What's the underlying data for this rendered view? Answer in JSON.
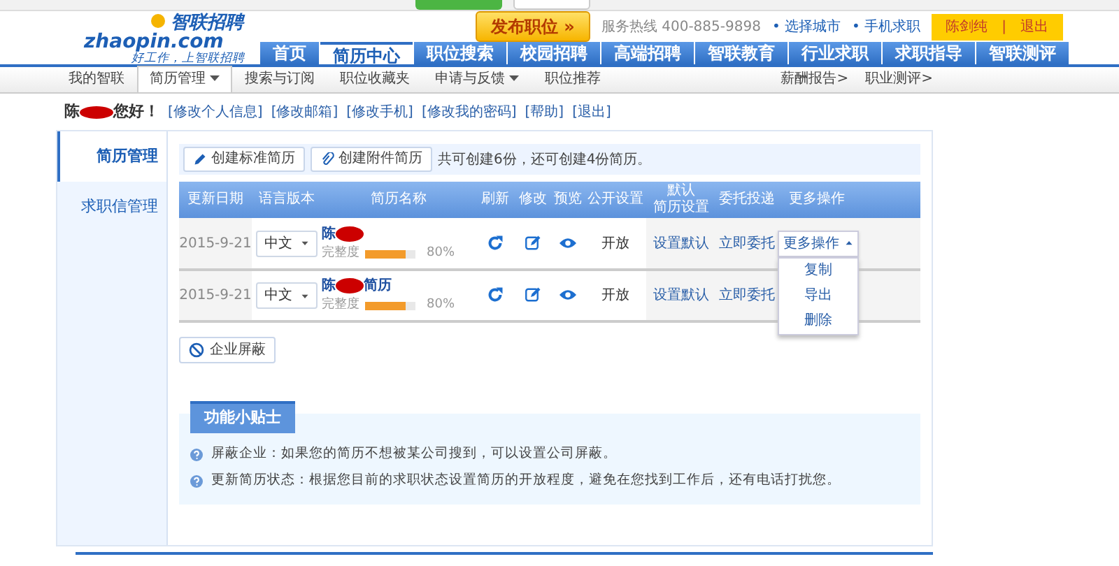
{
  "header": {
    "logo_cn": "智联招聘",
    "logo_en": "zhaopin.com",
    "slogan": "好工作，上智联招聘",
    "post_job": "发布职位 »",
    "hotline": "服务热线 400-885-9898",
    "links": [
      "• 选择城市",
      "• 手机求职"
    ],
    "user": {
      "name": "陈剑纯",
      "separator": "|",
      "logout": "退出"
    }
  },
  "main_nav": [
    {
      "label": "首页",
      "selected": false
    },
    {
      "label": "简历中心",
      "selected": true
    },
    {
      "label": "职位搜索",
      "selected": false
    },
    {
      "label": "校园招聘",
      "selected": false
    },
    {
      "label": "高端招聘",
      "selected": false
    },
    {
      "label": "智联教育",
      "selected": false
    },
    {
      "label": "行业求职",
      "selected": false
    },
    {
      "label": "求职指导",
      "selected": false
    },
    {
      "label": "智联测评",
      "selected": false
    }
  ],
  "sub_nav": [
    {
      "label": "我的智联",
      "selected": false,
      "caret": false
    },
    {
      "label": "简历管理",
      "selected": true,
      "caret": true
    },
    {
      "label": "搜索与订阅",
      "selected": false,
      "caret": false
    },
    {
      "label": "职位收藏夹",
      "selected": false,
      "caret": false
    },
    {
      "label": "申请与反馈",
      "selected": false,
      "caret": true
    },
    {
      "label": "职位推荐",
      "selected": false,
      "caret": false
    }
  ],
  "sub_nav_right": [
    "薪酬报告>",
    "职业测评>"
  ],
  "greeting": {
    "name": "陈",
    "redacted": true,
    "text": "您好！"
  },
  "account_links": [
    "[修改个人信息]",
    "[修改邮箱]",
    "[修改手机]",
    "[修改我的密码]",
    "[帮助]",
    "[退出]"
  ],
  "sidebar": [
    {
      "label": "简历管理",
      "selected": true
    },
    {
      "label": "求职信管理",
      "selected": false
    }
  ],
  "toolbar": {
    "buttons": [
      {
        "kind": "pencil",
        "label": "创建标准简历"
      },
      {
        "kind": "clip",
        "label": "创建附件简历"
      }
    ],
    "note": "共可创建6份，还可创建4份简历。"
  },
  "table": {
    "columns": [
      [
        "更新日期"
      ],
      [
        "语言版本"
      ],
      [
        "简历名称"
      ],
      [
        "刷新"
      ],
      [
        "修改"
      ],
      [
        "预览"
      ],
      [
        "公开设置"
      ],
      [
        "默认",
        "简历设置"
      ],
      [
        "委托投递"
      ],
      [
        "更多操作"
      ]
    ],
    "rows": [
      {
        "date": "2015-9-21",
        "language": "中文",
        "name": "陈",
        "redacted": true,
        "completeness": "完整度",
        "level": 0.8,
        "percent": "80%",
        "public": "开放",
        "default": "设置默认",
        "delegate": "立即委托",
        "more": "更多操作",
        "expanded": true,
        "menu": [
          "复制",
          "导出",
          "删除"
        ]
      },
      {
        "date": "2015-9-21",
        "language": "中文",
        "name": "陈",
        "redacted": true,
        "name_suffix": "简历",
        "completeness": "完整度",
        "level": 0.8,
        "percent": "80%",
        "public": "开放",
        "default": "设置默认",
        "delegate": "立即委托"
      }
    ]
  },
  "block_button": "企业屏蔽",
  "tips": {
    "title": "功能小贴士",
    "items": [
      "屏蔽企业：如果您的简历不想被某公司搜到，可以设置公司屏蔽。",
      "更新简历状态：根据您目前的求职状态设置简历的开放程度，避免在您找到工作后，还有电话打扰您。"
    ]
  }
}
